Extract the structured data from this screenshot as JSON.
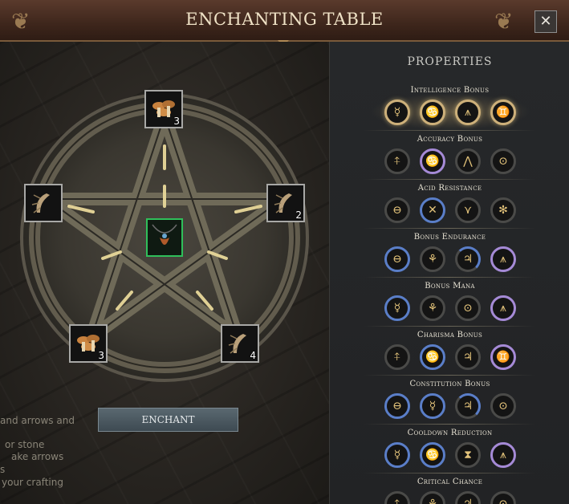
{
  "window": {
    "title": "ENCHANTING TABLE",
    "close_label": "✕"
  },
  "colors": {
    "header": "#4a2e22",
    "selected_slot": "#2fbf5a",
    "rune_glyph": "#e3c37a",
    "rune_blue": "#5a7ec8",
    "rune_purple": "#a58ad6",
    "rune_gold": "#cdb07a"
  },
  "table": {
    "slots": [
      {
        "name": "slot-top",
        "item": "mushroom-cluster-icon",
        "count": "3"
      },
      {
        "name": "slot-left",
        "item": "root-icon",
        "count": ""
      },
      {
        "name": "slot-right",
        "item": "root-icon",
        "count": "2"
      },
      {
        "name": "slot-bottom-left",
        "item": "mushroom-cluster-icon",
        "count": "3"
      },
      {
        "name": "slot-bottom-right",
        "item": "root-icon",
        "count": "4"
      }
    ],
    "center": {
      "item": "amulet-icon"
    }
  },
  "enchant_button": "ENCHANT",
  "background_text": [
    "and arrows and",
    "or stone",
    "ake arrows",
    "s",
    "your crafting"
  ],
  "properties": {
    "title": "PROPERTIES",
    "categories": [
      {
        "label": "Intelligence Bonus",
        "runes": [
          {
            "glyph": "☿",
            "ring": "gold"
          },
          {
            "glyph": "♋",
            "ring": "gold"
          },
          {
            "glyph": "⩚",
            "ring": "gold"
          },
          {
            "glyph": "♊",
            "ring": "gold"
          }
        ]
      },
      {
        "label": "Accuracy Bonus",
        "runes": [
          {
            "glyph": "⍏",
            "ring": "none"
          },
          {
            "glyph": "♋",
            "ring": "purple"
          },
          {
            "glyph": "⋀",
            "ring": "none"
          },
          {
            "glyph": "⊙",
            "ring": "none"
          }
        ]
      },
      {
        "label": "Acid Resistance",
        "runes": [
          {
            "glyph": "⊖",
            "ring": "none"
          },
          {
            "glyph": "✕",
            "ring": "blue"
          },
          {
            "glyph": "⋎",
            "ring": "none"
          },
          {
            "glyph": "✻",
            "ring": "none"
          }
        ]
      },
      {
        "label": "Bonus Endurance",
        "runes": [
          {
            "glyph": "⊖",
            "ring": "blue"
          },
          {
            "glyph": "⚘",
            "ring": "none"
          },
          {
            "glyph": "♃",
            "ring": "half-blue"
          },
          {
            "glyph": "⩚",
            "ring": "purple"
          }
        ]
      },
      {
        "label": "Bonus Mana",
        "runes": [
          {
            "glyph": "☿",
            "ring": "blue"
          },
          {
            "glyph": "⚘",
            "ring": "none"
          },
          {
            "glyph": "⊙",
            "ring": "none"
          },
          {
            "glyph": "⩚",
            "ring": "purple"
          }
        ]
      },
      {
        "label": "Charisma Bonus",
        "runes": [
          {
            "glyph": "⍏",
            "ring": "none"
          },
          {
            "glyph": "♋",
            "ring": "blue"
          },
          {
            "glyph": "♃",
            "ring": "none"
          },
          {
            "glyph": "♊",
            "ring": "purple"
          }
        ]
      },
      {
        "label": "Constitution Bonus",
        "runes": [
          {
            "glyph": "⊖",
            "ring": "blue"
          },
          {
            "glyph": "☿",
            "ring": "blue"
          },
          {
            "glyph": "♃",
            "ring": "half-blue"
          },
          {
            "glyph": "⊙",
            "ring": "none"
          }
        ]
      },
      {
        "label": "Cooldown Reduction",
        "runes": [
          {
            "glyph": "☿",
            "ring": "blue"
          },
          {
            "glyph": "♋",
            "ring": "blue"
          },
          {
            "glyph": "⧗",
            "ring": "none"
          },
          {
            "glyph": "⩚",
            "ring": "purple"
          }
        ]
      },
      {
        "label": "Critical Chance",
        "runes": [
          {
            "glyph": "⍏",
            "ring": "none"
          },
          {
            "glyph": "⚘",
            "ring": "none"
          },
          {
            "glyph": "♃",
            "ring": "none"
          },
          {
            "glyph": "⊙",
            "ring": "none"
          }
        ]
      }
    ]
  }
}
